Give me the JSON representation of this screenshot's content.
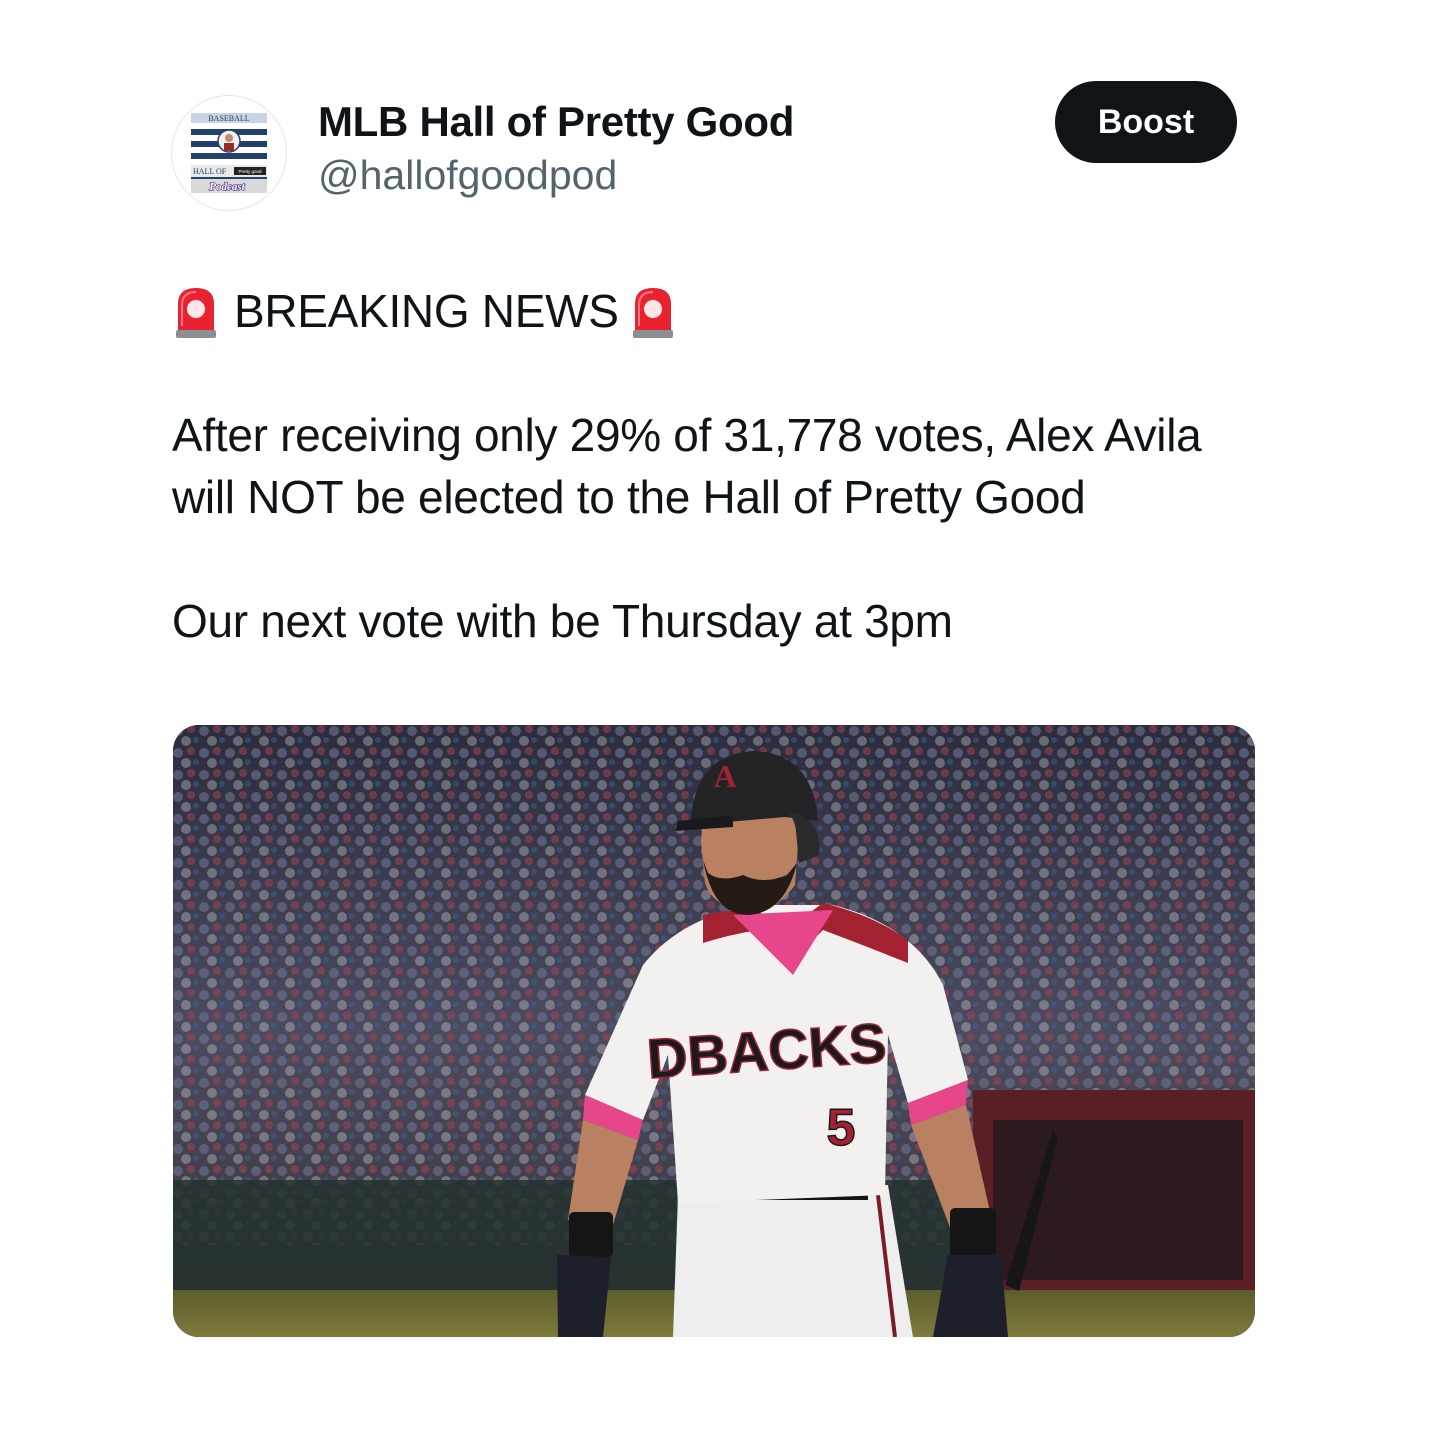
{
  "account": {
    "display_name": "MLB Hall of Pretty Good",
    "handle": "@hallofgoodpod",
    "avatar_texts": {
      "top": "BASEBALL",
      "middle": "HALL OF",
      "tag": "Pretty good",
      "bottom": "Podcast"
    }
  },
  "actions": {
    "boost_label": "Boost"
  },
  "post": {
    "headline": "BREAKING NEWS",
    "headline_icon": "rotating-light-icon",
    "paragraph1": "After receiving only 29% of 31,778 votes, Alex Avila will NOT be elected to the Hall of Pretty Good",
    "paragraph2": "Our next vote with be Thursday at 3pm"
  },
  "media": {
    "jersey_text": "DBACKS",
    "jersey_number": "5",
    "helmet_letter": "A"
  },
  "colors": {
    "text": "#0f1419",
    "secondary_text": "#536471",
    "button_bg": "#0f1419",
    "button_text": "#ffffff",
    "siren_red": "#e8222e"
  }
}
